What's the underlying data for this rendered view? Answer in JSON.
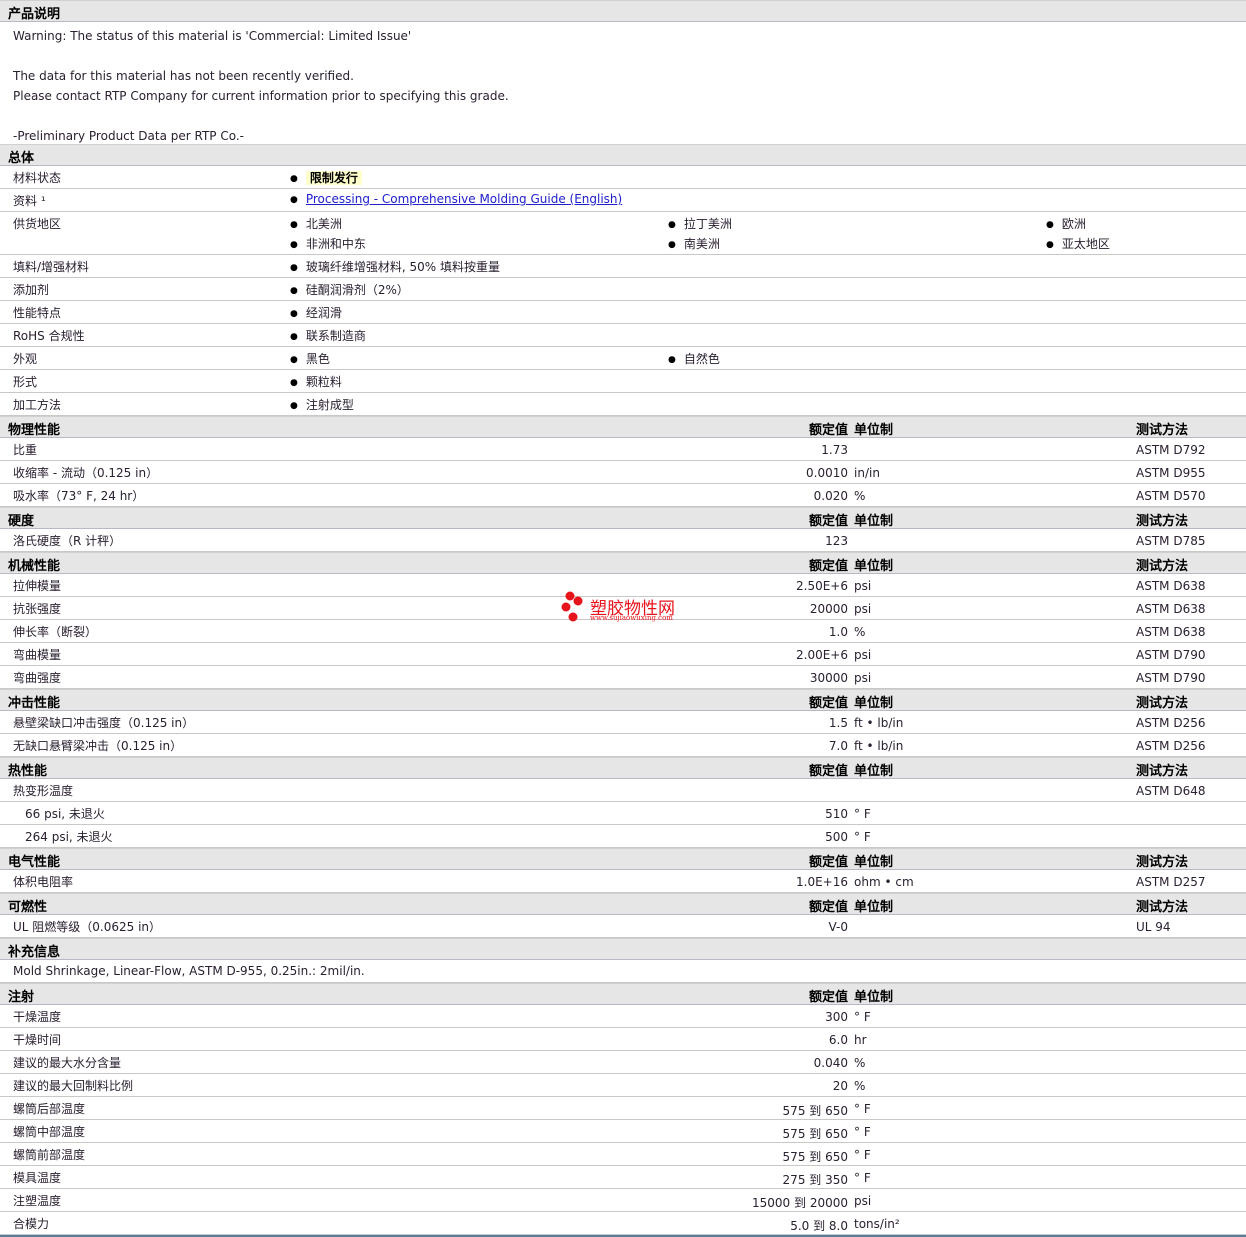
{
  "description": {
    "title": "产品说明",
    "lines": [
      "Warning: The status of this material is 'Commercial: Limited Issue'",
      "",
      "The data for this material has not been recently verified.",
      "Please contact RTP Company for current information prior to specifying this grade.",
      "",
      "-Preliminary Product Data per RTP Co.-"
    ]
  },
  "general": {
    "title": "总体",
    "rows": [
      {
        "label": "材料状态",
        "items": [
          [
            "限制发行"
          ]
        ],
        "highlight": true
      },
      {
        "label": "资料 ¹",
        "items": [
          [
            "Processing - Comprehensive Molding Guide (English)"
          ]
        ],
        "link": true
      },
      {
        "label": "供货地区",
        "items": [
          [
            "北美洲",
            "拉丁美洲",
            "欧洲"
          ],
          [
            "非洲和中东",
            "南美洲",
            "亚太地区"
          ]
        ]
      },
      {
        "label": "填料/增强材料",
        "items": [
          [
            "玻璃纤维增强材料, 50% 填料按重量"
          ]
        ]
      },
      {
        "label": "添加剂",
        "items": [
          [
            "硅酮润滑剂（2%）"
          ]
        ]
      },
      {
        "label": "性能特点",
        "items": [
          [
            "经润滑"
          ]
        ]
      },
      {
        "label": "RoHS 合规性",
        "items": [
          [
            "联系制造商"
          ]
        ]
      },
      {
        "label": "外观",
        "items": [
          [
            "黑色",
            "自然色"
          ]
        ]
      },
      {
        "label": "形式",
        "items": [
          [
            "颗粒料"
          ]
        ]
      },
      {
        "label": "加工方法",
        "items": [
          [
            "注射成型"
          ]
        ]
      }
    ]
  },
  "columns": {
    "value": "额定值",
    "unit": "单位制",
    "test": "测试方法"
  },
  "sections": [
    {
      "title": "物理性能",
      "cols": true,
      "rows": [
        {
          "label": "比重",
          "value": "1.73",
          "unit": "",
          "test": "ASTM D792"
        },
        {
          "label": "收缩率 - 流动（0.125 in）",
          "value": "0.0010",
          "unit": "in/in",
          "test": "ASTM D955"
        },
        {
          "label": "吸水率（73° F, 24 hr）",
          "value": "0.020",
          "unit": "%",
          "test": "ASTM D570"
        }
      ]
    },
    {
      "title": "硬度",
      "cols": true,
      "rows": [
        {
          "label": "洛氏硬度（R 计秤）",
          "value": "123",
          "unit": "",
          "test": "ASTM D785"
        }
      ]
    },
    {
      "title": "机械性能",
      "cols": true,
      "rows": [
        {
          "label": "拉伸模量",
          "value": "2.50E+6",
          "unit": "psi",
          "test": "ASTM D638"
        },
        {
          "label": "抗张强度",
          "value": "20000",
          "unit": "psi",
          "test": "ASTM D638"
        },
        {
          "label": "伸长率（断裂）",
          "value": "1.0",
          "unit": "%",
          "test": "ASTM D638"
        },
        {
          "label": "弯曲模量",
          "value": "2.00E+6",
          "unit": "psi",
          "test": "ASTM D790"
        },
        {
          "label": "弯曲强度",
          "value": "30000",
          "unit": "psi",
          "test": "ASTM D790"
        }
      ]
    },
    {
      "title": "冲击性能",
      "cols": true,
      "rows": [
        {
          "label": "悬壁梁缺口冲击强度（0.125 in）",
          "value": "1.5",
          "unit": "ft • lb/in",
          "test": "ASTM D256"
        },
        {
          "label": "无缺口悬臂梁冲击（0.125 in）",
          "value": "7.0",
          "unit": "ft • lb/in",
          "test": "ASTM D256"
        }
      ]
    },
    {
      "title": "热性能",
      "cols": true,
      "rows": [
        {
          "label": "热变形温度",
          "value": "",
          "unit": "",
          "test": "ASTM D648"
        },
        {
          "label": "66 psi, 未退火",
          "value": "510",
          "unit": "° F",
          "test": "",
          "indent": true
        },
        {
          "label": "264 psi, 未退火",
          "value": "500",
          "unit": "° F",
          "test": "",
          "indent": true
        }
      ]
    },
    {
      "title": "电气性能",
      "cols": true,
      "rows": [
        {
          "label": "体积电阻率",
          "value": "1.0E+16",
          "unit": "ohm • cm",
          "test": "ASTM D257"
        }
      ]
    },
    {
      "title": "可燃性",
      "cols": true,
      "rows": [
        {
          "label": "UL 阻燃等级（0.0625 in）",
          "value": "V-0",
          "unit": "",
          "test": "UL 94"
        }
      ]
    },
    {
      "title": "补充信息",
      "cols": false,
      "rows": [
        {
          "note": "Mold Shrinkage, Linear-Flow, ASTM D-955, 0.25in.: 2mil/in."
        }
      ]
    },
    {
      "title": "注射",
      "cols": true,
      "notest": true,
      "rows": [
        {
          "label": "干燥温度",
          "value": "300",
          "unit": "° F"
        },
        {
          "label": "干燥时间",
          "value": "6.0",
          "unit": "hr"
        },
        {
          "label": "建议的最大水分含量",
          "value": "0.040",
          "unit": "%"
        },
        {
          "label": "建议的最大回制料比例",
          "value": "20",
          "unit": "%"
        },
        {
          "label": "螺筒后部温度",
          "value": "575 到  650",
          "unit": "° F"
        },
        {
          "label": "螺筒中部温度",
          "value": "575 到  650",
          "unit": "° F"
        },
        {
          "label": "螺筒前部温度",
          "value": "575 到  650",
          "unit": "° F"
        },
        {
          "label": "模具温度",
          "value": "275 到  350",
          "unit": "° F"
        },
        {
          "label": "注塑温度",
          "value": "15000 到  20000",
          "unit": "psi"
        },
        {
          "label": "合模力",
          "value": "5.0 到  8.0",
          "unit": "tons/in²"
        }
      ]
    }
  ],
  "watermark": {
    "name": "塑胶物性网",
    "url": "www.sujiaowuxing.com",
    "color": "#e8141c"
  }
}
